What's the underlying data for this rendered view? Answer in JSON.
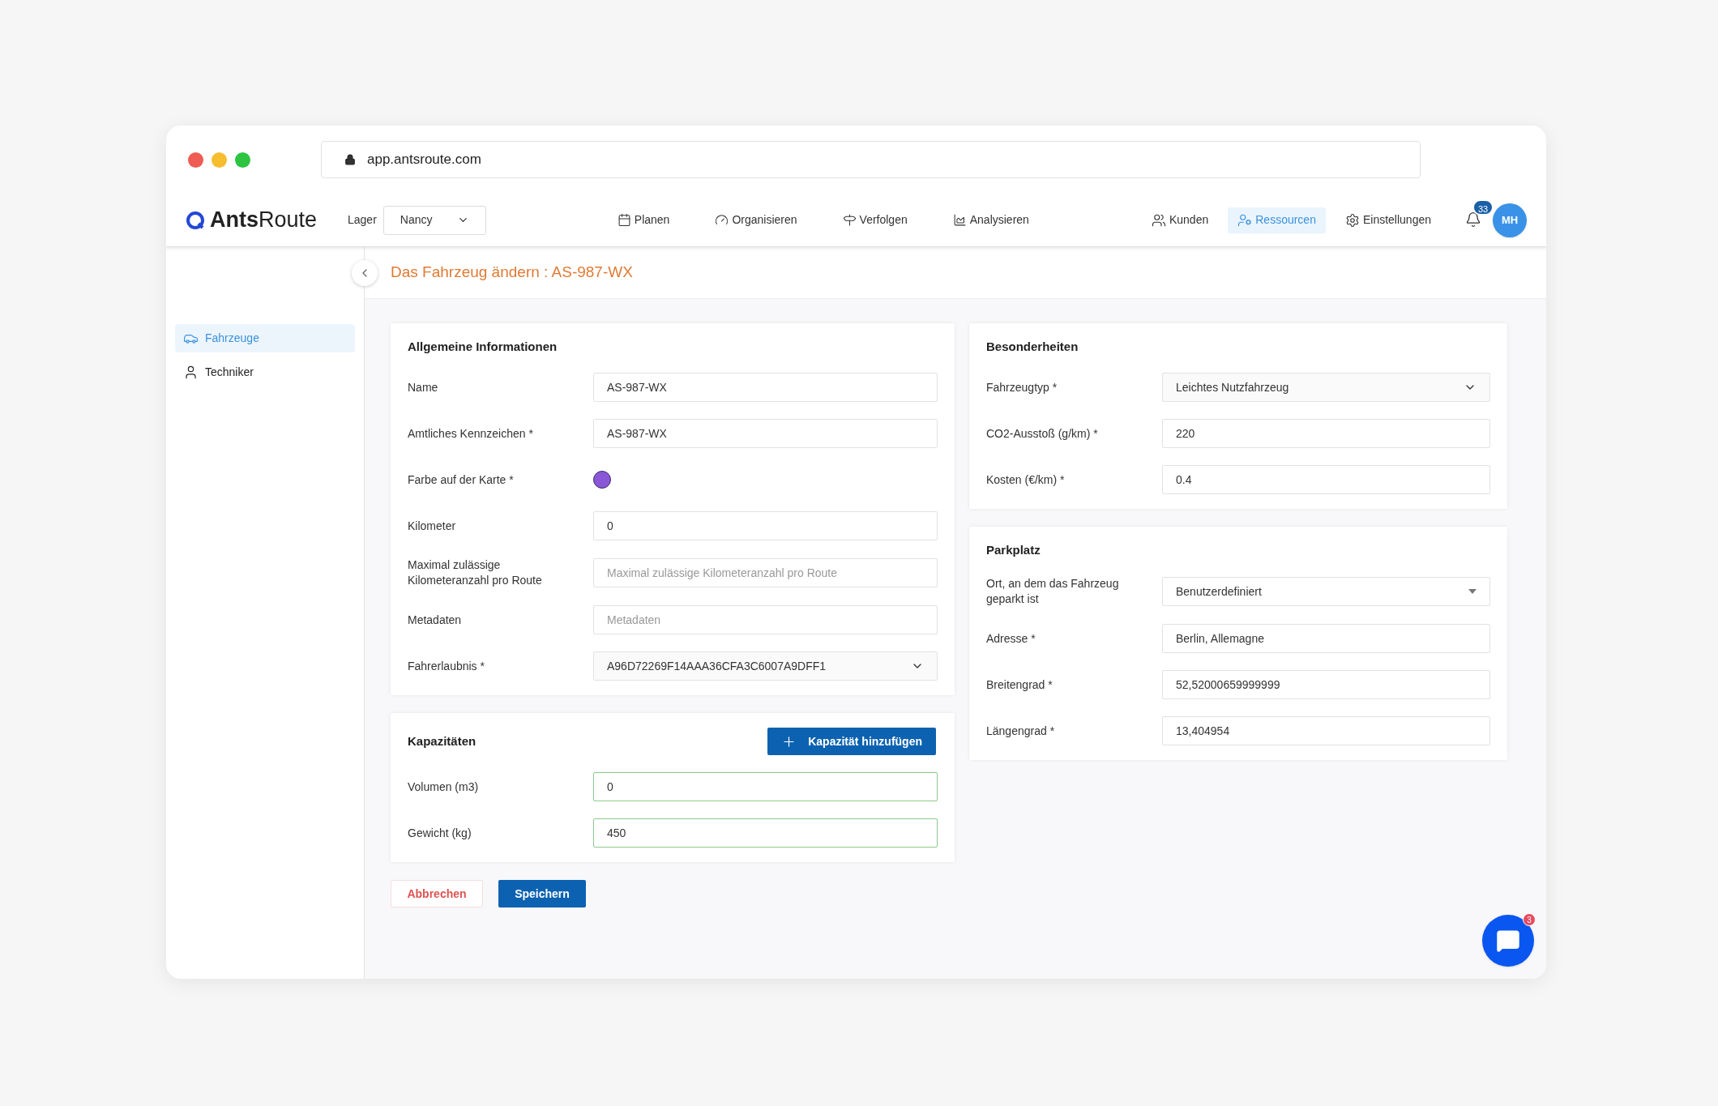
{
  "browser": {
    "url": "app.antsroute.com"
  },
  "header": {
    "logo_bold": "Ants",
    "logo_light": "Route",
    "depot_label": "Lager",
    "depot_value": "Nancy",
    "nav": [
      {
        "label": "Planen",
        "selected": false
      },
      {
        "label": "Organisieren",
        "selected": false
      },
      {
        "label": "Verfolgen",
        "selected": false
      },
      {
        "label": "Analysieren",
        "selected": false
      }
    ],
    "right_nav": [
      {
        "label": "Kunden",
        "selected": false
      },
      {
        "label": "Ressourcen",
        "selected": true
      },
      {
        "label": "Einstellungen",
        "selected": false
      }
    ],
    "notifications": "33",
    "avatar": "MH"
  },
  "sidebar": {
    "items": [
      {
        "label": "Fahrzeuge",
        "selected": true
      },
      {
        "label": "Techniker",
        "selected": false
      }
    ]
  },
  "page_title": "Das Fahrzeug ändern : AS-987-WX",
  "general": {
    "title": "Allgemeine Informationen",
    "fields": [
      {
        "kind": "text",
        "label": "Name",
        "value": "AS-987-WX"
      },
      {
        "kind": "text",
        "label": "Amtliches Kennzeichen *",
        "value": "AS-987-WX"
      },
      {
        "kind": "color",
        "label": "Farbe auf der Karte *",
        "color": "#8a58d6"
      },
      {
        "kind": "text",
        "label": "Kilometer",
        "value": "0"
      },
      {
        "kind": "text",
        "label": "Maximal zulässige Kilometeranzahl pro Route",
        "placeholder": "Maximal zulässige Kilometeranzahl pro Route"
      },
      {
        "kind": "text",
        "label": "Metadaten",
        "placeholder": "Metadaten"
      },
      {
        "kind": "select",
        "label": "Fahrerlaubnis *",
        "value": "A96D72269F14AAA36CFA3C6007A9DFF1"
      }
    ]
  },
  "capacities": {
    "title": "Kapazitäten",
    "add_button": "Kapazität hinzufügen",
    "fields": [
      {
        "kind": "valid",
        "label": "Volumen (m3)",
        "value": "0"
      },
      {
        "kind": "valid",
        "label": "Gewicht (kg)",
        "value": "450"
      }
    ]
  },
  "actions": {
    "cancel": "Abbrechen",
    "save": "Speichern"
  },
  "features": {
    "title": "Besonderheiten",
    "fields": [
      {
        "kind": "select",
        "label": "Fahrzeugtyp *",
        "value": "Leichtes Nutzfahrzeug"
      },
      {
        "kind": "text",
        "label": "CO2-Ausstoß (g/km) *",
        "value": "220"
      },
      {
        "kind": "text",
        "label": "Kosten (€/km) *",
        "value": "0.4"
      }
    ]
  },
  "parking": {
    "title": "Parkplatz",
    "fields": [
      {
        "kind": "dropdown",
        "label": "Ort, an dem das Fahrzeug geparkt ist",
        "value": "Benutzerdefiniert"
      },
      {
        "kind": "text",
        "label": "Adresse *",
        "value": "Berlin, Allemagne"
      },
      {
        "kind": "text",
        "label": "Breitengrad *",
        "value": "52,52000659999999"
      },
      {
        "kind": "text",
        "label": "Längengrad *",
        "value": "13,404954"
      }
    ]
  },
  "chat": {
    "badge": "3"
  }
}
